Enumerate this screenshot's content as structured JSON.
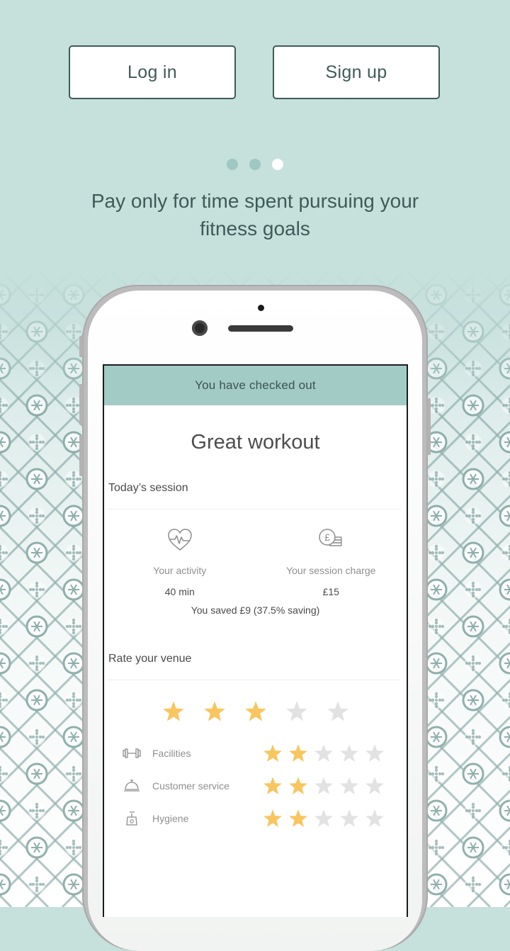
{
  "auth": {
    "login_label": "Log in",
    "signup_label": "Sign up"
  },
  "carousel": {
    "total": 3,
    "active": 3
  },
  "tagline": "Pay only for time spent pursuing your fitness goals",
  "screen": {
    "banner": "You have checked out",
    "title": "Great workout",
    "session_label": "Today’s session",
    "activity": {
      "label": "Your activity",
      "value": "40 min",
      "icon": "heart-pulse-icon"
    },
    "charge": {
      "label": "Your session charge",
      "value": "£15",
      "icon": "pound-coins-icon"
    },
    "saved": "You saved £9 (37.5% saving)",
    "rate_label": "Rate your venue",
    "overall_rating": 3,
    "max_rating": 5,
    "categories": [
      {
        "label": "Facilities",
        "rating": 2,
        "icon": "dumbbell-icon"
      },
      {
        "label": "Customer service",
        "rating": 2,
        "icon": "service-bell-icon"
      },
      {
        "label": "Hygiene",
        "rating": 2,
        "icon": "soap-dispenser-icon"
      }
    ]
  },
  "colors": {
    "accent": "#a3cbc6",
    "background": "#c6e0dc",
    "star_on": "#f8c55e",
    "star_off": "#e2e2e2",
    "pattern": "#7fa39f"
  }
}
